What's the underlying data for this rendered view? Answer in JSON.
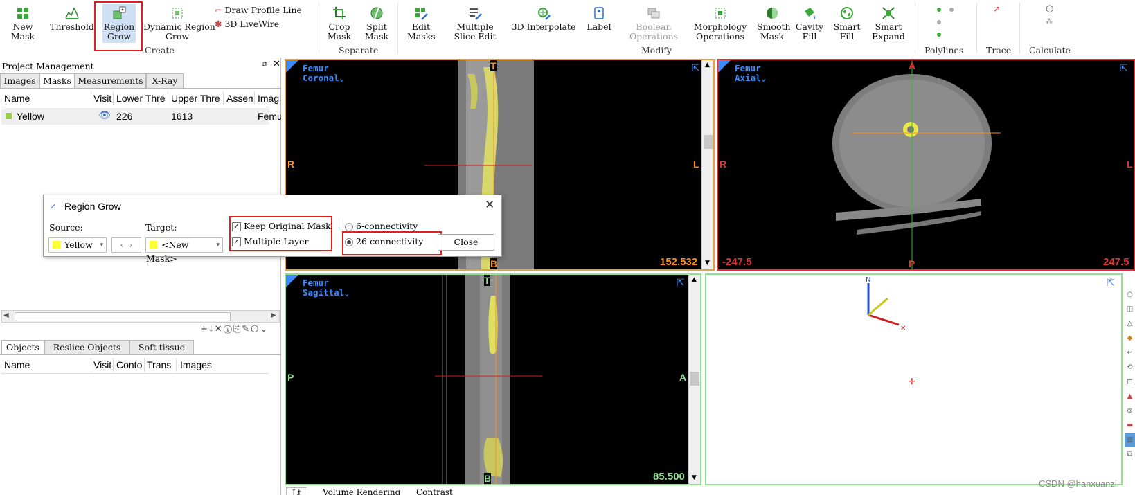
{
  "ribbon": {
    "create": {
      "new_mask": "New\nMask",
      "threshold": "Threshold",
      "region_grow": "Region\nGrow",
      "dynamic_region_grow": "Dynamic Region\nGrow",
      "draw_profile_line": "Draw Profile Line",
      "live_wire_3d": "3D LiveWire",
      "group": "Create"
    },
    "separate": {
      "crop_mask": "Crop\nMask",
      "split_mask": "Split\nMask",
      "group": "Separate"
    },
    "modify": {
      "edit_masks": "Edit\nMasks",
      "multiple_slice_edit": "Multiple\nSlice Edit",
      "interpolate_3d": "3D Interpolate",
      "label": "Label",
      "boolean_operations": "Boolean\nOperations",
      "morphology_operations": "Morphology\nOperations",
      "smooth_mask": "Smooth\nMask",
      "cavity_fill": "Cavity\nFill",
      "smart_fill": "Smart\nFill",
      "smart_expand": "Smart\nExpand",
      "group": "Modify"
    },
    "polylines_group": "Polylines",
    "trace_group": "Trace",
    "calculate_group": "Calculate"
  },
  "project": {
    "title": "Project Management",
    "tabs": [
      "Images",
      "Masks",
      "Measurements",
      "X-Ray"
    ],
    "mask_columns": [
      "Name",
      "Visit",
      "Lower Thre",
      "Upper Thre",
      "Assem",
      "Imag"
    ],
    "mask_rows": [
      {
        "name": "Yellow",
        "visible": "👁",
        "lower": "226",
        "upper": "1613",
        "image": "Femu",
        "color": "#9acd50"
      }
    ],
    "object_tabs": [
      "Objects",
      "Reslice Objects",
      "Soft tissue"
    ],
    "object_columns": [
      "Name",
      "Visit",
      "Conto",
      "Trans",
      "Images"
    ]
  },
  "views": {
    "coronal": {
      "title": "Femur",
      "orientation": "Coronal",
      "top": "T",
      "bottom": "B",
      "left": "R",
      "right": "L",
      "value": "152.532"
    },
    "axial": {
      "title": "Femur",
      "orientation": "Axial",
      "top": "A",
      "bottom": "P",
      "left": "R",
      "right": "L",
      "value_left": "-247.5",
      "value_right": "247.5"
    },
    "sagittal": {
      "title": "Femur",
      "orientation": "Sagittal",
      "top": "T",
      "bottom": "B",
      "left": "P",
      "right": "A",
      "value": "85.500"
    }
  },
  "dialog": {
    "title": "Region Grow",
    "source_label": "Source:",
    "source_value": "Yellow",
    "target_label": "Target:",
    "target_value": "<New Mask>",
    "keep_original_mask": "Keep Original Mask",
    "multiple_layer": "Multiple Layer",
    "conn6": "6-connectivity",
    "conn26": "26-connectivity",
    "close": "Close"
  },
  "bottom_tabs": [
    "Lt",
    "Volume Rendering",
    "Contrast"
  ],
  "watermark": "CSDN @hanxuanzi",
  "colors": {
    "accent": "#3c8cff",
    "highlight": "#e02020",
    "mask": "#ffff33",
    "coronal_border": "#f0a030",
    "axial_border": "#e53030",
    "sagittal_border": "#90e090"
  }
}
